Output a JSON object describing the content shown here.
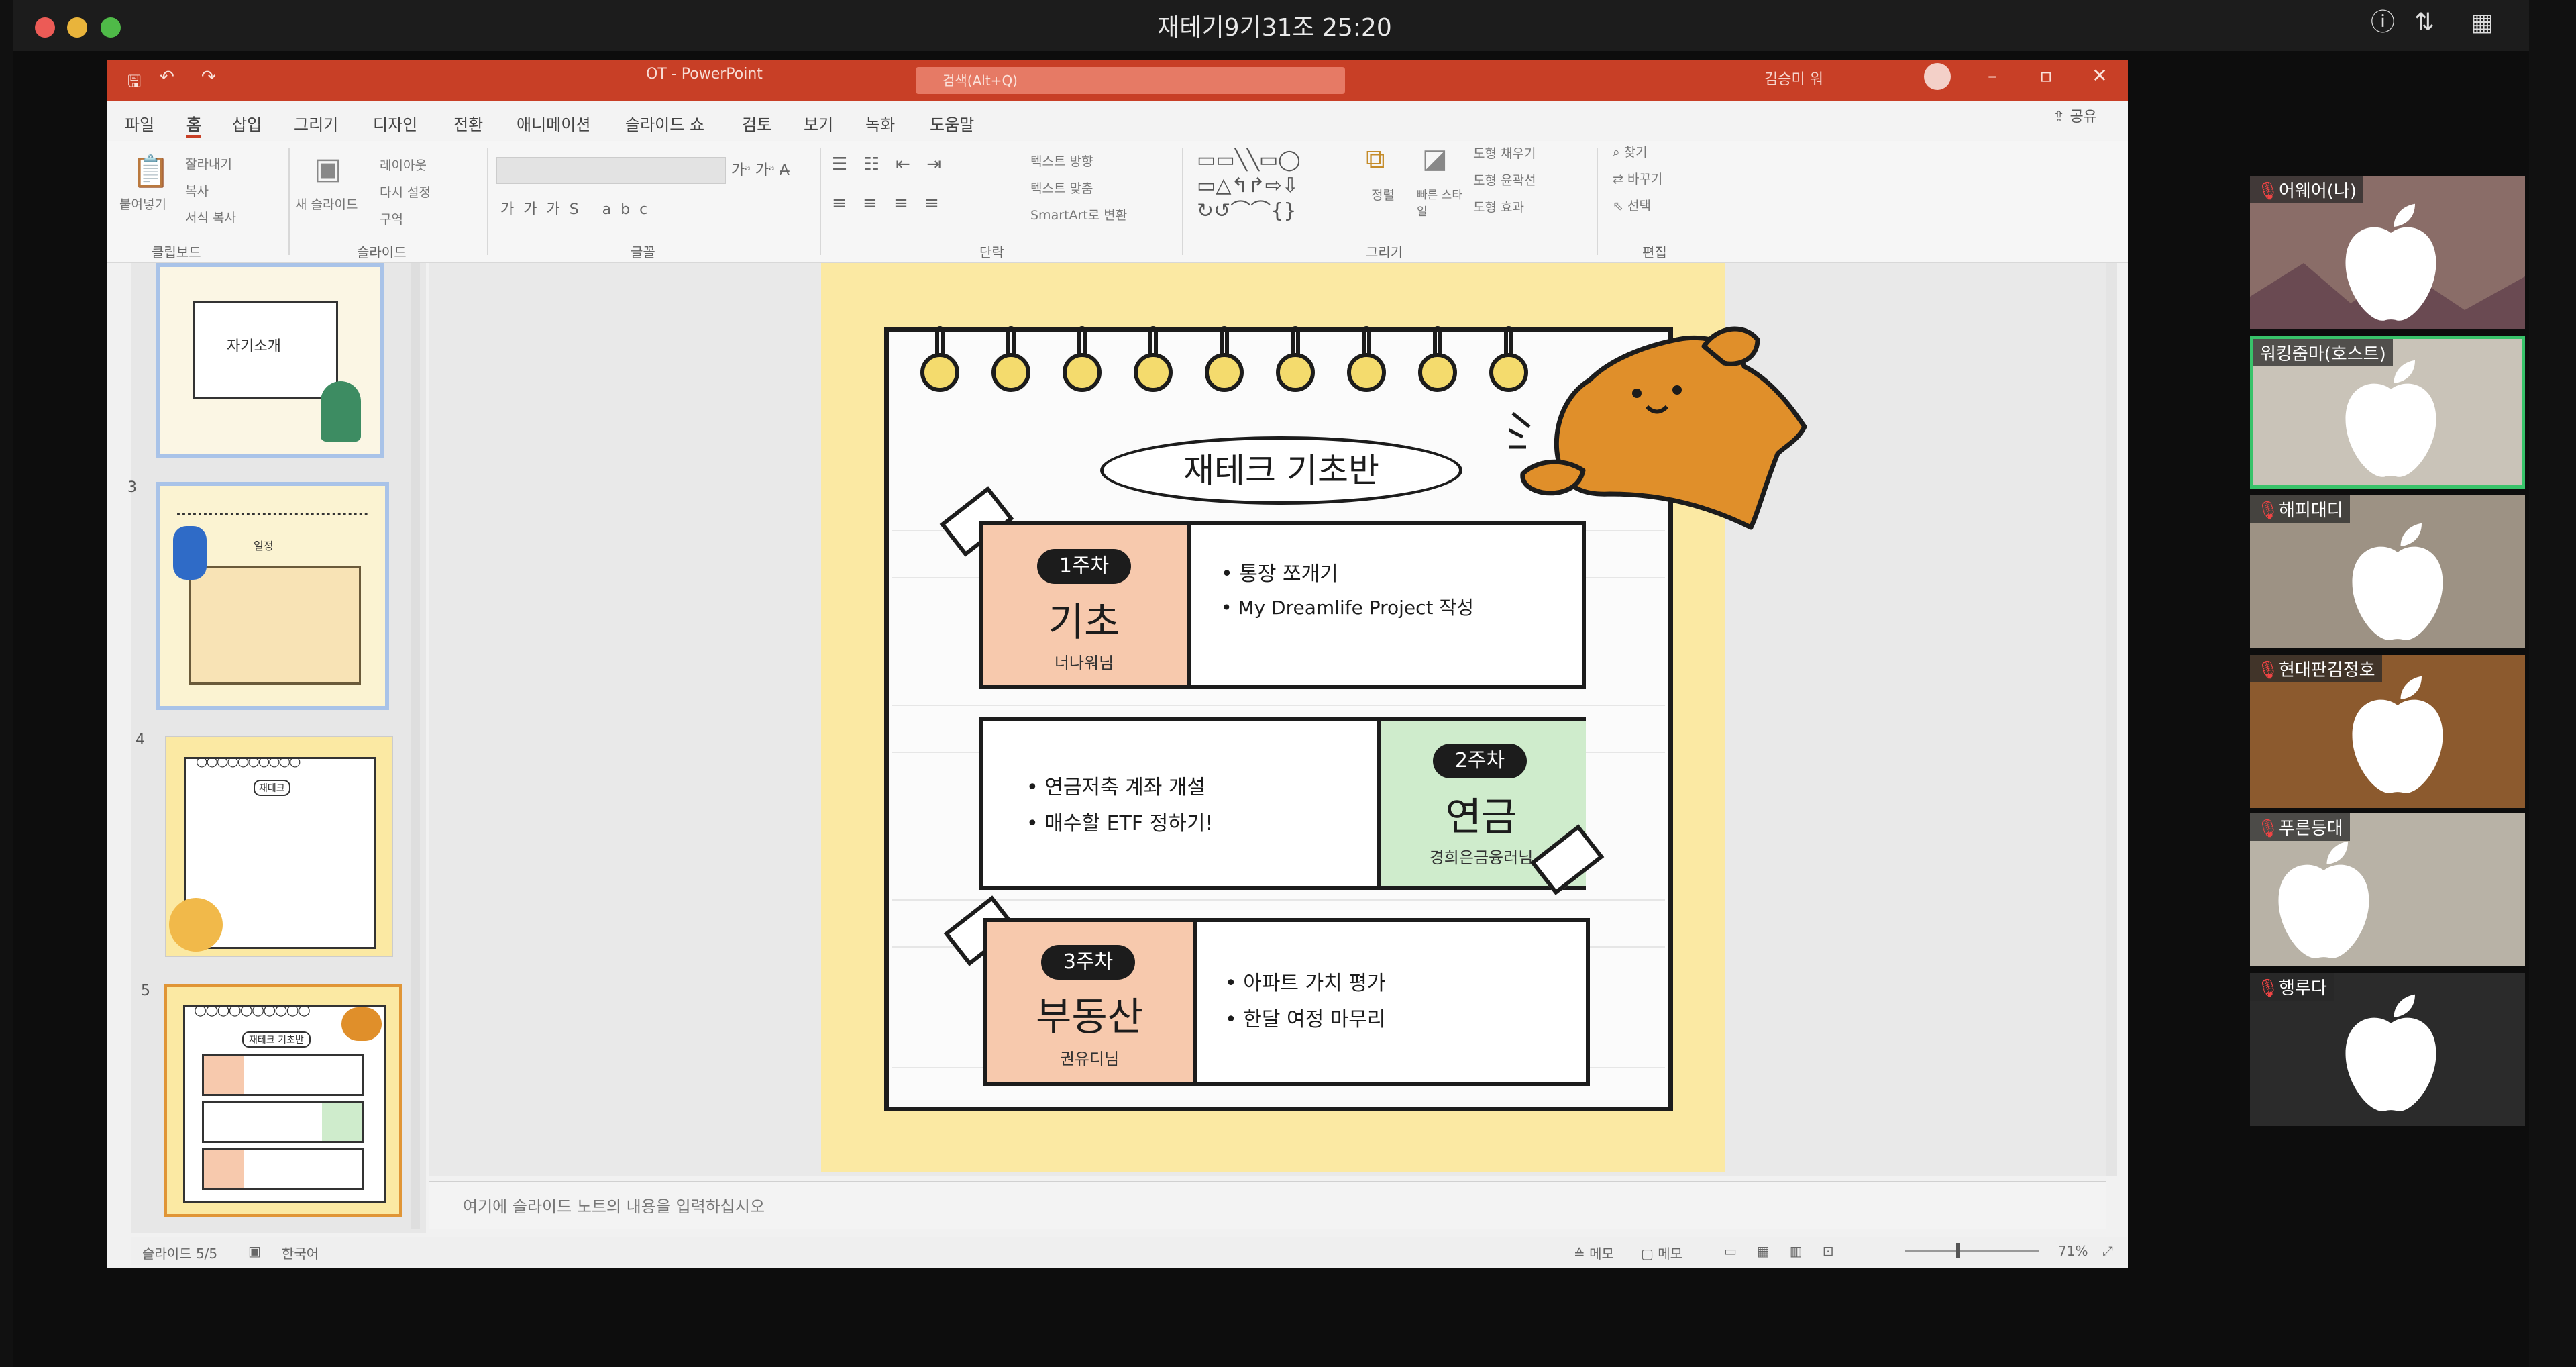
{
  "meeting": {
    "title": "재테기9기31조 25:20",
    "icons": [
      "info-icon",
      "sort-icon",
      "grid-view-icon"
    ]
  },
  "ppt": {
    "doc_title": "OT - PowerPoint",
    "search_placeholder": "검색(Alt+Q)",
    "user_name": "김승미 워",
    "menu": [
      "파일",
      "홈",
      "삽입",
      "그리기",
      "디자인",
      "전환",
      "애니메이션",
      "슬라이드 쇼",
      "검토",
      "보기",
      "녹화",
      "도움말"
    ],
    "share_label": "공유",
    "ribbon": {
      "groups": [
        "클립보드",
        "슬라이드",
        "글꼴",
        "단락",
        "그리기",
        "편집"
      ],
      "paste_label": "붙여넣기",
      "cut_label": "잘라내기",
      "copy_label": "복사",
      "format_copy_label": "서식 복사",
      "new_slide_label": "새 슬라이드",
      "layout_label": "레이아웃",
      "reset_label": "다시 설정",
      "section_label": "구역",
      "text_direction_label": "텍스트 방향",
      "text_align_label": "텍스트 맞춤",
      "smartart_label": "SmartArt로 변환",
      "arrange_label": "정렬",
      "quick_style_label": "빠른 스타일",
      "shape_fill_label": "도형 채우기",
      "shape_outline_label": "도형 윤곽선",
      "shape_effect_label": "도형 효과",
      "find_label": "찾기",
      "replace_label": "바꾸기",
      "select_label": "선택"
    },
    "thumbnails": [
      {
        "num": "",
        "title": "자기소개"
      },
      {
        "num": "3",
        "title": "일정"
      },
      {
        "num": "4",
        "title": "재테크"
      },
      {
        "num": "5",
        "title": "재테크 기초반"
      }
    ],
    "notes_placeholder": "여기에 슬라이드 노트의 내용을 입력하십시오",
    "status": {
      "slide_info": "슬라이드 5/5",
      "language": "한국어",
      "notes_btn": "메모",
      "comments_btn": "메모",
      "zoom": "71%"
    }
  },
  "slide": {
    "title": "재테크 기초반",
    "weeks": [
      {
        "badge": "1주차",
        "name": "기초",
        "teacher": "너나워님",
        "bullets": [
          "통장 쪼개기",
          "My Dreamlife Project 작성"
        ],
        "color": "#f7c9ad"
      },
      {
        "badge": "2주차",
        "name": "연금",
        "teacher": "경희은금융러님",
        "bullets": [
          "연금저축 계좌 개설",
          "매수할 ETF 정하기!"
        ],
        "color": "#cfeccc"
      },
      {
        "badge": "3주차",
        "name": "부동산",
        "teacher": "권유디님",
        "bullets": [
          "아파트 가치 평가",
          "한달 여정 마무리"
        ],
        "color": "#f7c9ad"
      }
    ]
  },
  "participants": [
    {
      "name": "어웨어(나)",
      "bg": "#8a6d68"
    },
    {
      "name": "워킹줌마(호스트)",
      "bg": "#c9c3b8",
      "active": true
    },
    {
      "name": "해피대디",
      "bg": "#9d9284"
    },
    {
      "name": "현대판김정호",
      "bg": "#8c5a2e"
    },
    {
      "name": "푸른등대",
      "bg": "#b8b2a6"
    },
    {
      "name": "행루다",
      "bg": "#2b2b2b"
    }
  ]
}
